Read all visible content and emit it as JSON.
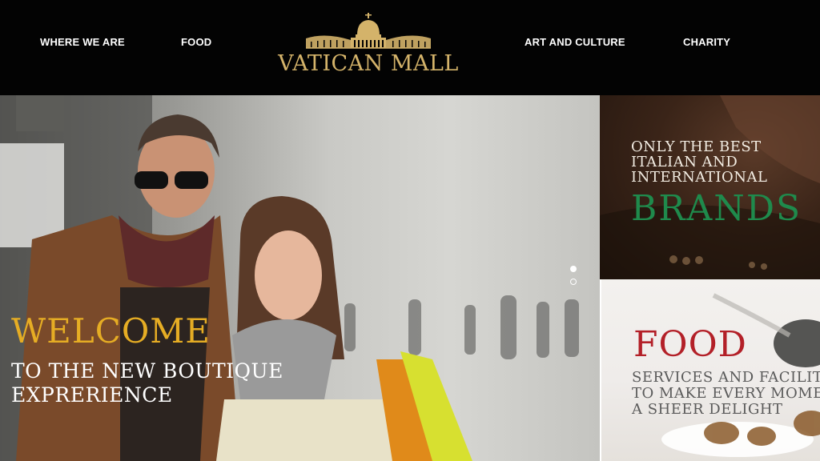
{
  "nav": {
    "left": [
      "WHERE WE ARE",
      "FOOD"
    ],
    "right": [
      "ART AND CULTURE",
      "CHARITY"
    ]
  },
  "logo": {
    "text": "VATICAN MALL",
    "icon": "basilica-icon",
    "color": "#d4b36a"
  },
  "hero": {
    "title": "WELCOME",
    "subtitle_lines": [
      "TO THE NEW BOUTIQUE",
      "EXPRERIENCE"
    ],
    "slides": {
      "count": 2,
      "active": 1
    },
    "title_color": "#e6ad24"
  },
  "promos": {
    "brands": {
      "lead_lines": [
        "ONLY THE BEST",
        "ITALIAN AND",
        "INTERNATIONAL"
      ],
      "title": "BRANDS",
      "title_color": "#1f8a4c"
    },
    "food": {
      "title": "FOOD",
      "sub_lines": [
        "SERVICES AND FACILITIES",
        "TO MAKE EVERY MOMENT",
        "A SHEER DELIGHT"
      ],
      "title_color": "#b32028"
    }
  }
}
